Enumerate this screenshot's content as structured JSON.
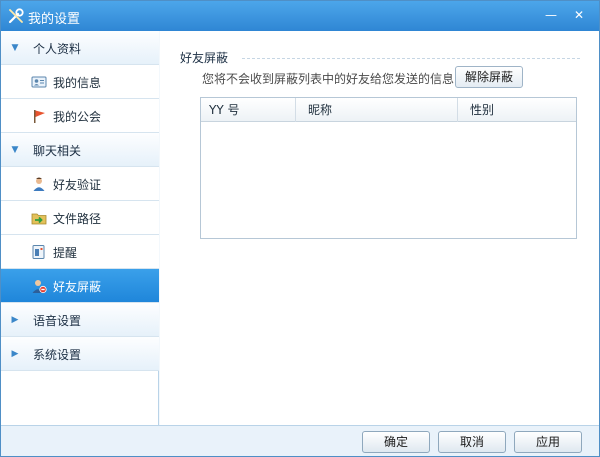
{
  "window": {
    "title": "我的设置",
    "title_icon": "wrench-screwdriver-icon",
    "minimize_glyph": "—",
    "close_glyph": "✕"
  },
  "sidebar": {
    "categories": [
      {
        "label": "个人资料",
        "expanded": true,
        "arrow": "▼"
      },
      {
        "label": "聊天相关",
        "expanded": true,
        "arrow": "▼"
      },
      {
        "label": "语音设置",
        "expanded": false,
        "arrow": "▶"
      },
      {
        "label": "系统设置",
        "expanded": false,
        "arrow": "▶"
      }
    ],
    "items": [
      {
        "label": "我的信息",
        "icon": "id-card-icon"
      },
      {
        "label": "我的公会",
        "icon": "flag-icon"
      },
      {
        "label": "好友验证",
        "icon": "user-verify-icon"
      },
      {
        "label": "文件路径",
        "icon": "folder-arrow-icon"
      },
      {
        "label": "提醒",
        "icon": "reminder-icon"
      },
      {
        "label": "好友屏蔽",
        "icon": "user-block-icon",
        "selected": true
      }
    ]
  },
  "main": {
    "section_title": "好友屏蔽",
    "description": "您将不会收到屏蔽列表中的好友给您发送的信息",
    "unblock_button": "解除屏蔽",
    "table": {
      "columns": [
        "YY 号",
        "昵称",
        "性别"
      ],
      "rows": []
    }
  },
  "footer": {
    "ok_label": "确定",
    "cancel_label": "取消",
    "apply_label": "应用"
  },
  "colors": {
    "titlebar": "#2f86d4",
    "selected_item": "#1f86da",
    "accent": "#3b87c9"
  }
}
